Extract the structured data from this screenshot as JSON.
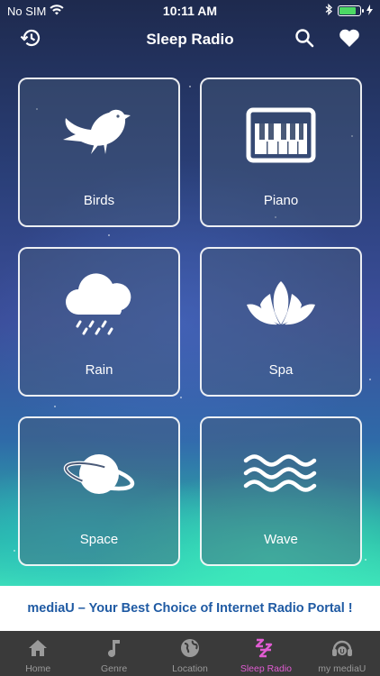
{
  "status_bar": {
    "carrier": "No SIM",
    "time": "10:11 AM",
    "battery_level": 0.8
  },
  "nav": {
    "title": "Sleep Radio",
    "left_icon": "history-icon",
    "right_icons": [
      "search-icon",
      "heart-icon"
    ]
  },
  "categories": [
    {
      "label": "Birds",
      "icon": "bird-icon"
    },
    {
      "label": "Piano",
      "icon": "piano-icon"
    },
    {
      "label": "Rain",
      "icon": "rain-cloud-icon"
    },
    {
      "label": "Spa",
      "icon": "lotus-icon"
    },
    {
      "label": "Space",
      "icon": "planet-icon"
    },
    {
      "label": "Wave",
      "icon": "wave-icon"
    }
  ],
  "banner": {
    "text": "mediaU – Your Best Choice of Internet Radio Portal !"
  },
  "tabs": [
    {
      "label": "Home",
      "icon": "home-icon",
      "active": false
    },
    {
      "label": "Genre",
      "icon": "music-note-icon",
      "active": false
    },
    {
      "label": "Location",
      "icon": "globe-icon",
      "active": false
    },
    {
      "label": "Sleep Radio",
      "icon": "zzz-icon",
      "active": true
    },
    {
      "label": "my mediaU",
      "icon": "mediau-user-icon",
      "active": false
    }
  ],
  "colors": {
    "active_tab": "#e05cd2",
    "inactive_tab": "#9a9a9a",
    "banner_text": "#1f5aa3",
    "battery_fill": "#4cd964"
  }
}
